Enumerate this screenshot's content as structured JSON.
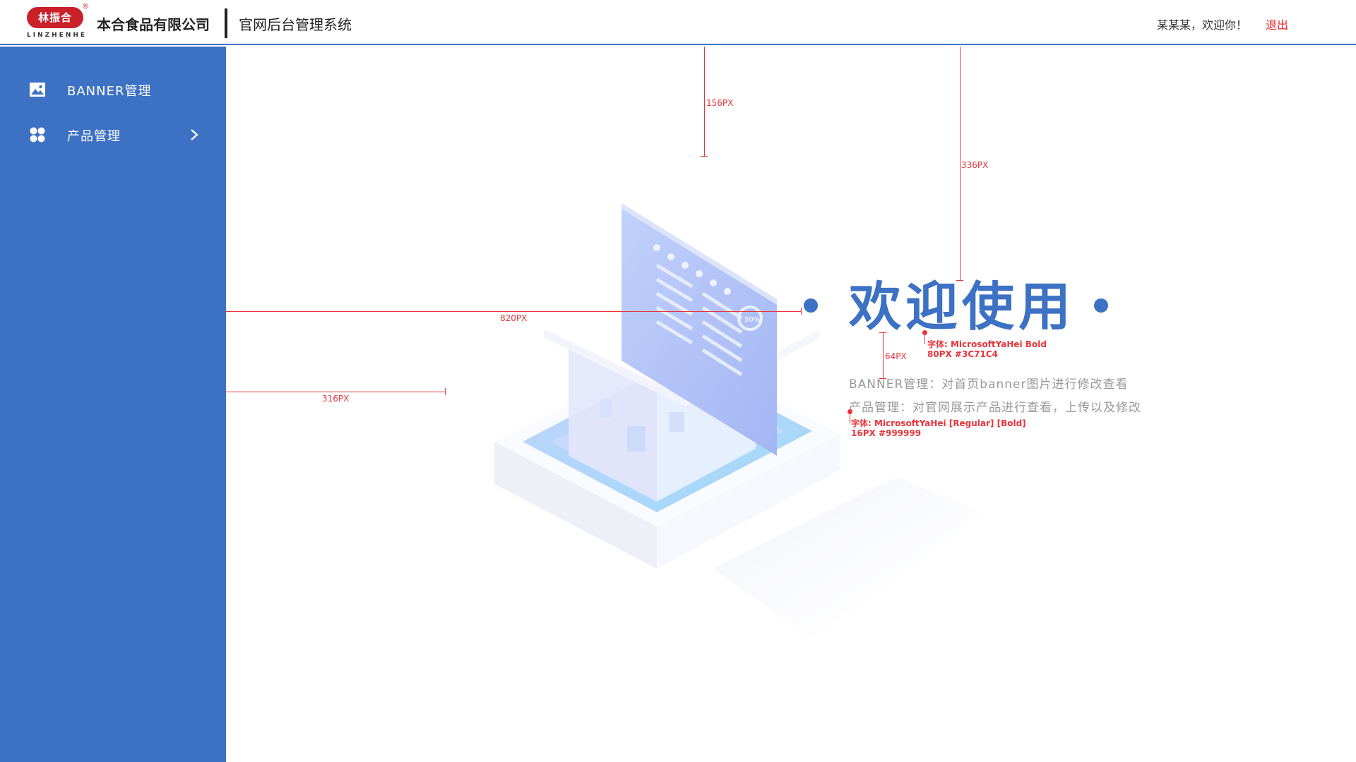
{
  "header": {
    "logo_cn": "林振合",
    "logo_reg": "®",
    "logo_en": "LINZHENHE",
    "company": "本合食品有限公司",
    "system_name": "官网后台管理系统",
    "user_greeting": "某某某，欢迎你！",
    "logout": "退出"
  },
  "sidebar": {
    "items": [
      {
        "label": "BANNER管理",
        "icon": "image-icon"
      },
      {
        "label": "产品管理",
        "icon": "grid-dots-icon",
        "has_submenu": true
      }
    ]
  },
  "main": {
    "title": "欢迎使用",
    "desc": [
      "BANNER管理：对首页banner图片进行修改查看",
      "产品管理：对官网展示产品进行查看，上传以及修改"
    ],
    "illustration_badge": "50%"
  },
  "annotations": {
    "top_gap_1": "156PX",
    "top_gap_2": "336PX",
    "left_gap_title": "820PX",
    "left_gap_illus": "316PX",
    "title_desc_gap": "64PX",
    "title_font_1": "字体: MicrosoftYaHei Bold",
    "title_font_2": "80PX #3C71C4",
    "desc_font_1": "字体: MicrosoftYaHei [Regular] [Bold]",
    "desc_font_2": "16PX #999999"
  },
  "colors": {
    "primary": "#3C71C4",
    "logout": "#e8232b",
    "annotation": "#e8343c",
    "desc_text": "#999999"
  }
}
